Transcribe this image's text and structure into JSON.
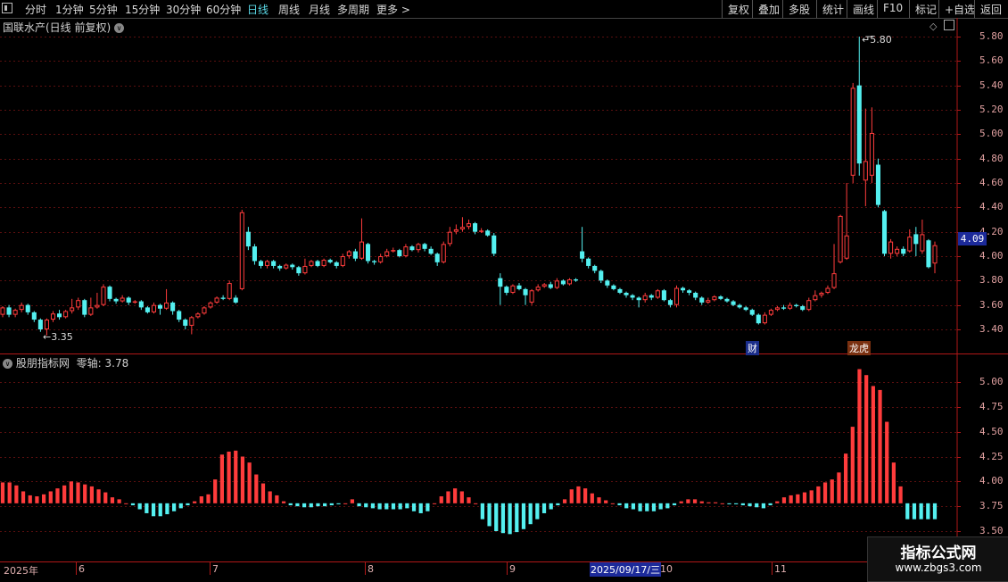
{
  "toolbar": {
    "periods": [
      "分时",
      "1分钟",
      "5分钟",
      "15分钟",
      "30分钟",
      "60分钟",
      "日线",
      "周线",
      "月线",
      "多周期",
      "更多 >"
    ],
    "active_period": "日线",
    "right_buttons": [
      "复权",
      "叠加",
      "多股",
      "统计",
      "画线",
      "F10",
      "标记",
      "+自选",
      "返回"
    ]
  },
  "stock": {
    "title": "国联水产(日线 前复权)",
    "high_label": "5.80",
    "low_label": "3.35",
    "current_price": "4.09",
    "price_ticks": [
      "5.80",
      "5.60",
      "5.40",
      "5.20",
      "5.00",
      "4.80",
      "4.60",
      "4.40",
      "4.20",
      "4.00",
      "3.80",
      "3.60",
      "3.40"
    ],
    "tag_cai": "财",
    "tag_long": "龙虎"
  },
  "indicator": {
    "title": "股朋指标网",
    "zero_axis_label": "零轴: 3.78",
    "ticks": [
      "5.00",
      "4.75",
      "4.50",
      "4.25",
      "4.00",
      "3.75",
      "3.50"
    ]
  },
  "dates": {
    "year": "2025年",
    "months": [
      "6",
      "7",
      "8",
      "9",
      "10",
      "11"
    ],
    "cursor": "2025/09/17/三"
  },
  "watermark": {
    "title": "指标公式网",
    "url": "www.zbgs3.com"
  },
  "colors": {
    "up": "#ff3c3c",
    "down": "#54f0f0",
    "grid": "#5a0f0f",
    "border": "#b01818",
    "active_tab": "#5ad8e6",
    "price_box": "#1c2a9a"
  },
  "chart_data": [
    {
      "type": "candlestick",
      "title": "国联水产(日线 前复权)",
      "ylim": [
        3.3,
        5.9
      ],
      "ticks": [
        3.4,
        3.6,
        3.8,
        4.0,
        4.2,
        4.4,
        4.6,
        4.8,
        5.0,
        5.2,
        5.4,
        5.6,
        5.8
      ],
      "candles": [
        [
          3.52,
          3.58,
          3.59,
          3.5
        ],
        [
          3.58,
          3.52,
          3.6,
          3.5
        ],
        [
          3.52,
          3.56,
          3.57,
          3.5
        ],
        [
          3.56,
          3.6,
          3.62,
          3.54
        ],
        [
          3.6,
          3.54,
          3.61,
          3.52
        ],
        [
          3.54,
          3.48,
          3.55,
          3.46
        ],
        [
          3.48,
          3.4,
          3.49,
          3.38
        ],
        [
          3.4,
          3.48,
          3.49,
          3.35
        ],
        [
          3.48,
          3.53,
          3.55,
          3.46
        ],
        [
          3.53,
          3.5,
          3.56,
          3.48
        ],
        [
          3.5,
          3.55,
          3.56,
          3.49
        ],
        [
          3.55,
          3.58,
          3.65,
          3.53
        ],
        [
          3.58,
          3.64,
          3.66,
          3.56
        ],
        [
          3.64,
          3.52,
          3.65,
          3.5
        ],
        [
          3.52,
          3.58,
          3.66,
          3.51
        ],
        [
          3.58,
          3.6,
          3.7,
          3.57
        ],
        [
          3.6,
          3.75,
          3.77,
          3.59
        ],
        [
          3.75,
          3.65,
          3.76,
          3.63
        ],
        [
          3.65,
          3.63,
          3.66,
          3.61
        ],
        [
          3.63,
          3.66,
          3.68,
          3.62
        ],
        [
          3.66,
          3.62,
          3.67,
          3.6
        ],
        [
          3.62,
          3.63,
          3.64,
          3.61
        ],
        [
          3.63,
          3.58,
          3.64,
          3.56
        ],
        [
          3.58,
          3.54,
          3.59,
          3.53
        ],
        [
          3.54,
          3.6,
          3.62,
          3.53
        ],
        [
          3.6,
          3.57,
          3.61,
          3.52
        ],
        [
          3.57,
          3.62,
          3.73,
          3.56
        ],
        [
          3.62,
          3.55,
          3.63,
          3.52
        ],
        [
          3.55,
          3.48,
          3.56,
          3.46
        ],
        [
          3.48,
          3.43,
          3.49,
          3.4
        ],
        [
          3.43,
          3.5,
          3.51,
          3.36
        ],
        [
          3.5,
          3.53,
          3.54,
          3.49
        ],
        [
          3.53,
          3.58,
          3.59,
          3.52
        ],
        [
          3.58,
          3.62,
          3.63,
          3.57
        ],
        [
          3.62,
          3.66,
          3.67,
          3.61
        ],
        [
          3.66,
          3.65,
          3.68,
          3.64
        ],
        [
          3.65,
          3.78,
          3.8,
          3.64
        ],
        [
          3.66,
          3.62,
          3.68,
          3.61
        ],
        [
          3.73,
          4.36,
          4.38,
          3.72
        ],
        [
          4.2,
          4.08,
          4.24,
          4.05
        ],
        [
          4.08,
          3.96,
          4.1,
          3.93
        ],
        [
          3.96,
          3.92,
          3.97,
          3.9
        ],
        [
          3.92,
          3.96,
          3.97,
          3.9
        ],
        [
          3.96,
          3.92,
          3.97,
          3.9
        ],
        [
          3.92,
          3.9,
          3.93,
          3.88
        ],
        [
          3.9,
          3.93,
          3.94,
          3.89
        ],
        [
          3.93,
          3.91,
          3.94,
          3.89
        ],
        [
          3.91,
          3.86,
          3.92,
          3.84
        ],
        [
          3.86,
          3.92,
          3.98,
          3.85
        ],
        [
          3.92,
          3.96,
          3.97,
          3.91
        ],
        [
          3.96,
          3.92,
          3.97,
          3.91
        ],
        [
          3.92,
          3.97,
          3.98,
          3.91
        ],
        [
          3.97,
          3.95,
          3.98,
          3.94
        ],
        [
          3.95,
          3.92,
          3.96,
          3.9
        ],
        [
          3.92,
          4.0,
          4.02,
          3.91
        ],
        [
          4.0,
          4.04,
          4.05,
          3.98
        ],
        [
          4.04,
          3.98,
          4.06,
          3.96
        ],
        [
          3.98,
          4.12,
          4.31,
          3.97
        ],
        [
          4.1,
          3.96,
          4.11,
          3.94
        ],
        [
          3.96,
          3.95,
          3.97,
          3.93
        ],
        [
          3.95,
          4.0,
          4.02,
          3.94
        ],
        [
          4.0,
          4.04,
          4.06,
          3.99
        ],
        [
          4.04,
          4.05,
          4.07,
          4.03
        ],
        [
          4.05,
          4.0,
          4.06,
          3.99
        ],
        [
          4.0,
          4.08,
          4.1,
          3.99
        ],
        [
          4.08,
          4.05,
          4.09,
          4.04
        ],
        [
          4.05,
          4.1,
          4.11,
          4.03
        ],
        [
          4.1,
          4.06,
          4.11,
          4.04
        ],
        [
          4.06,
          4.02,
          4.08,
          4.01
        ],
        [
          4.02,
          3.95,
          4.03,
          3.92
        ],
        [
          3.95,
          4.1,
          4.12,
          3.94
        ],
        [
          4.1,
          4.2,
          4.24,
          4.08
        ],
        [
          4.2,
          4.22,
          4.26,
          4.18
        ],
        [
          4.22,
          4.24,
          4.32,
          4.2
        ],
        [
          4.24,
          4.27,
          4.3,
          4.22
        ],
        [
          4.27,
          4.2,
          4.28,
          4.18
        ],
        [
          4.2,
          4.21,
          4.23,
          4.19
        ],
        [
          4.21,
          4.17,
          4.22,
          4.16
        ],
        [
          4.17,
          4.02,
          4.19,
          4.0
        ],
        [
          3.82,
          3.75,
          3.86,
          3.6
        ],
        [
          3.75,
          3.7,
          3.76,
          3.68
        ],
        [
          3.7,
          3.76,
          3.77,
          3.69
        ],
        [
          3.76,
          3.73,
          3.78,
          3.72
        ],
        [
          3.73,
          3.68,
          3.74,
          3.6
        ],
        [
          3.62,
          3.72,
          3.73,
          3.6
        ],
        [
          3.72,
          3.75,
          3.77,
          3.71
        ],
        [
          3.75,
          3.77,
          3.78,
          3.74
        ],
        [
          3.77,
          3.74,
          3.79,
          3.73
        ],
        [
          3.74,
          3.8,
          3.82,
          3.73
        ],
        [
          3.8,
          3.77,
          3.81,
          3.76
        ],
        [
          3.77,
          3.81,
          3.82,
          3.76
        ],
        [
          3.81,
          3.8,
          3.82,
          3.79
        ],
        [
          4.04,
          3.98,
          4.24,
          3.95
        ],
        [
          3.98,
          3.92,
          3.99,
          3.9
        ],
        [
          3.92,
          3.88,
          3.93,
          3.86
        ],
        [
          3.88,
          3.8,
          3.89,
          3.78
        ],
        [
          3.8,
          3.76,
          3.81,
          3.74
        ],
        [
          3.76,
          3.73,
          3.77,
          3.72
        ],
        [
          3.73,
          3.7,
          3.74,
          3.69
        ],
        [
          3.7,
          3.68,
          3.71,
          3.66
        ],
        [
          3.68,
          3.66,
          3.69,
          3.64
        ],
        [
          3.66,
          3.64,
          3.67,
          3.58
        ],
        [
          3.64,
          3.68,
          3.7,
          3.62
        ],
        [
          3.68,
          3.66,
          3.69,
          3.64
        ],
        [
          3.66,
          3.72,
          3.73,
          3.65
        ],
        [
          3.72,
          3.64,
          3.73,
          3.63
        ],
        [
          3.64,
          3.6,
          3.65,
          3.58
        ],
        [
          3.6,
          3.74,
          3.76,
          3.58
        ],
        [
          3.74,
          3.72,
          3.75,
          3.7
        ],
        [
          3.72,
          3.7,
          3.73,
          3.68
        ],
        [
          3.7,
          3.66,
          3.71,
          3.64
        ],
        [
          3.66,
          3.62,
          3.67,
          3.6
        ],
        [
          3.62,
          3.64,
          3.66,
          3.61
        ],
        [
          3.64,
          3.67,
          3.68,
          3.63
        ],
        [
          3.67,
          3.65,
          3.68,
          3.64
        ],
        [
          3.65,
          3.63,
          3.66,
          3.62
        ],
        [
          3.63,
          3.6,
          3.64,
          3.59
        ],
        [
          3.6,
          3.58,
          3.61,
          3.57
        ],
        [
          3.58,
          3.56,
          3.59,
          3.55
        ],
        [
          3.56,
          3.52,
          3.57,
          3.51
        ],
        [
          3.52,
          3.45,
          3.53,
          3.44
        ],
        [
          3.45,
          3.52,
          3.54,
          3.44
        ],
        [
          3.52,
          3.56,
          3.57,
          3.51
        ],
        [
          3.56,
          3.58,
          3.59,
          3.55
        ],
        [
          3.58,
          3.57,
          3.6,
          3.56
        ],
        [
          3.57,
          3.6,
          3.62,
          3.56
        ],
        [
          3.6,
          3.59,
          3.61,
          3.58
        ],
        [
          3.59,
          3.56,
          3.6,
          3.55
        ],
        [
          3.56,
          3.64,
          3.66,
          3.55
        ],
        [
          3.64,
          3.68,
          3.72,
          3.63
        ],
        [
          3.68,
          3.7,
          3.71,
          3.66
        ],
        [
          3.7,
          3.74,
          3.76,
          3.69
        ],
        [
          3.74,
          3.86,
          4.1,
          3.73
        ],
        [
          3.95,
          4.33,
          4.34,
          3.94
        ],
        [
          3.98,
          4.17,
          4.6,
          3.97
        ],
        [
          4.66,
          5.38,
          5.42,
          4.6
        ],
        [
          5.4,
          4.76,
          5.8,
          4.66
        ],
        [
          4.62,
          4.78,
          5.21,
          4.41
        ],
        [
          4.66,
          5.01,
          5.22,
          4.6
        ],
        [
          4.75,
          4.42,
          4.8,
          4.4
        ],
        [
          4.37,
          4.02,
          4.38,
          4.0
        ],
        [
          4.02,
          4.12,
          4.14,
          3.98
        ],
        [
          4.02,
          4.06,
          4.08,
          4.0
        ],
        [
          4.06,
          4.02,
          4.08,
          4.0
        ],
        [
          4.04,
          4.16,
          4.22,
          4.03
        ],
        [
          4.18,
          4.1,
          4.24,
          4.0
        ],
        [
          4.04,
          4.18,
          4.3,
          4.02
        ],
        [
          4.13,
          3.91,
          4.14,
          3.9
        ],
        [
          3.94,
          4.09,
          4.12,
          3.86
        ]
      ]
    },
    {
      "type": "bar",
      "title": "股朋指标网",
      "ylim": [
        3.45,
        5.25
      ],
      "baseline": 3.78,
      "ticks": [
        3.5,
        3.75,
        4.0,
        4.25,
        4.5,
        4.75,
        5.0
      ],
      "values": [
        3.99,
        3.99,
        3.96,
        3.9,
        3.86,
        3.85,
        3.87,
        3.9,
        3.93,
        3.96,
        4.0,
        3.99,
        3.97,
        3.95,
        3.92,
        3.89,
        3.84,
        3.82,
        3.78,
        3.76,
        3.72,
        3.68,
        3.65,
        3.65,
        3.67,
        3.7,
        3.73,
        3.76,
        3.8,
        3.85,
        3.87,
        4.02,
        4.27,
        4.3,
        4.31,
        4.25,
        4.19,
        4.07,
        3.98,
        3.9,
        3.86,
        3.8,
        3.76,
        3.75,
        3.74,
        3.74,
        3.75,
        3.75,
        3.76,
        3.77,
        3.78,
        3.82,
        3.75,
        3.74,
        3.73,
        3.72,
        3.72,
        3.72,
        3.72,
        3.73,
        3.7,
        3.68,
        3.7,
        3.78,
        3.85,
        3.9,
        3.93,
        3.9,
        3.84,
        3.78,
        3.62,
        3.55,
        3.5,
        3.48,
        3.47,
        3.49,
        3.52,
        3.57,
        3.62,
        3.68,
        3.72,
        3.76,
        3.82,
        3.92,
        3.95,
        3.93,
        3.88,
        3.84,
        3.81,
        3.78,
        3.76,
        3.73,
        3.72,
        3.7,
        3.7,
        3.7,
        3.72,
        3.73,
        3.76,
        3.8,
        3.82,
        3.82,
        3.8,
        3.79,
        3.79,
        3.78,
        3.77,
        3.77,
        3.76,
        3.75,
        3.74,
        3.73,
        3.76,
        3.8,
        3.84,
        3.86,
        3.87,
        3.89,
        3.91,
        3.95,
        3.99,
        4.02,
        4.09,
        4.28,
        4.55,
        5.13,
        5.07,
        4.96,
        4.92,
        4.6,
        4.19,
        3.95,
        3.62,
        3.62,
        3.62,
        3.62,
        3.62
      ]
    }
  ]
}
